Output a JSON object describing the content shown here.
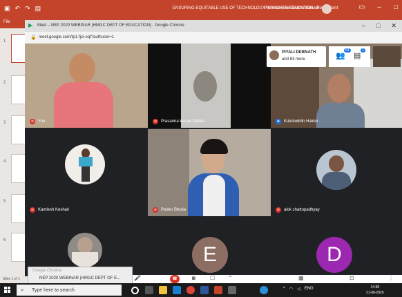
{
  "ppt": {
    "title": "ENSURING EQUITABLE USE OF TECHNOLOGY IN HIGHER EDUCATION - PowerPoint",
    "user": "Professor Ramakanta Mohalik",
    "file_tab": "File",
    "slide_numbers": [
      "1",
      "2",
      "3",
      "4",
      "5",
      "6"
    ],
    "status": "Slide 1 of 1"
  },
  "chrome": {
    "window_title": "Meet – NEP 2020 WEBINAR (HMGC DEPT OF EDUCATION) - Google Chrome",
    "url": "meet.google.com/tp1-fjxi-oqt?authuser=1"
  },
  "meet": {
    "overlay": {
      "name": "PIYALI DEBNATH",
      "more": "and 63 more",
      "people_badge": "64",
      "chat_badge": "1"
    },
    "tiles": [
      {
        "name": "You",
        "mic": "off"
      },
      {
        "name": "Prasanna kumar Pahari",
        "mic": "off"
      },
      {
        "name": "Kutubuddin Halder",
        "mic": "on"
      },
      {
        "name": "Kamlesh Keshari",
        "mic": "off"
      },
      {
        "name": "Peden Bhutia",
        "mic": "off"
      },
      {
        "name": "alok chattopadhyay",
        "mic": "off"
      },
      {
        "name": "",
        "mic": "off"
      },
      {
        "name": "E",
        "mic": "off"
      },
      {
        "name": "D",
        "mic": "off"
      }
    ]
  },
  "popup": {
    "line1": "Google Chrome",
    "line2": "NEP 2020 WEBINAR (HMGC DEPT OF E..."
  },
  "taskbar": {
    "search_placeholder": "Type here to search",
    "time": "14:38",
    "date": "21-06-2020",
    "lang": "ENG"
  }
}
